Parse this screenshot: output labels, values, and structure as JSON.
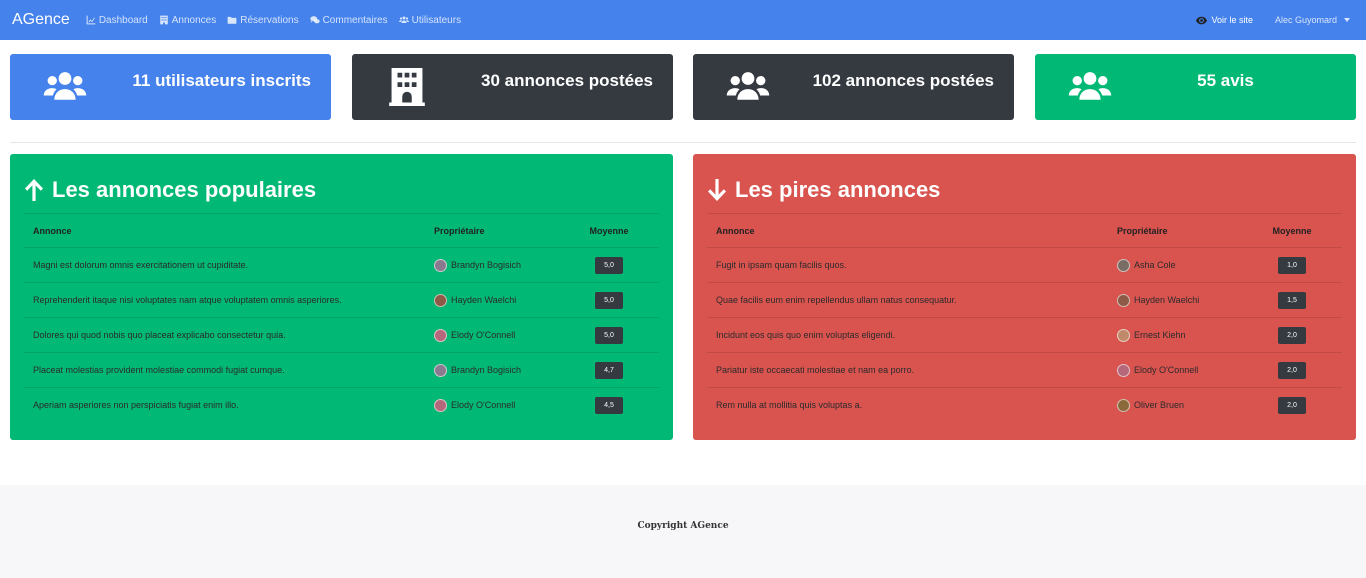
{
  "nav": {
    "brand": "AGence",
    "links": [
      {
        "label": "Dashboard",
        "icon": "chart-line-icon"
      },
      {
        "label": "Annonces",
        "icon": "building-icon"
      },
      {
        "label": "Réservations",
        "icon": "folder-icon"
      },
      {
        "label": "Commentaires",
        "icon": "comments-icon"
      },
      {
        "label": "Utilisateurs",
        "icon": "users-icon"
      }
    ],
    "view_site": "Voir le site",
    "user": "Alec Guyomard"
  },
  "stats": [
    {
      "text": "11 utilisateurs inscrits",
      "icon": "users-icon",
      "color": "#4582ec"
    },
    {
      "text": "30 annonces postées",
      "icon": "building-icon",
      "color": "#343a40"
    },
    {
      "text": "102 annonces postées",
      "icon": "users-icon",
      "color": "#343a40"
    },
    {
      "text": "55 avis",
      "icon": "users-icon",
      "color": "#02b875"
    }
  ],
  "popular": {
    "title": "Les annonces populaires",
    "headers": {
      "annonce": "Annonce",
      "owner": "Propriétaire",
      "avg": "Moyenne"
    },
    "rows": [
      {
        "annonce": "Magni est dolorum omnis exercitationem ut cupiditate.",
        "owner": "Brandyn Bogisich",
        "avg": "5,0",
        "avatar_color": "#8a7a8f"
      },
      {
        "annonce": "Reprehenderit itaque nisi voluptates nam atque voluptatem omnis asperiores.",
        "owner": "Hayden Waelchi",
        "avg": "5,0",
        "avatar_color": "#8c5a47"
      },
      {
        "annonce": "Dolores qui quod nobis quo placeat explicabo consectetur quia.",
        "owner": "Elody O'Connell",
        "avg": "5,0",
        "avatar_color": "#b4687a"
      },
      {
        "annonce": "Placeat molestias provident molestiae commodi fugiat cumque.",
        "owner": "Brandyn Bogisich",
        "avg": "4,7",
        "avatar_color": "#8a7a8f"
      },
      {
        "annonce": "Aperiam asperiores non perspiciatis fugiat enim illo.",
        "owner": "Elody O'Connell",
        "avg": "4,5",
        "avatar_color": "#b4687a"
      }
    ]
  },
  "worst": {
    "title": "Les pires annonces",
    "headers": {
      "annonce": "Annonce",
      "owner": "Propriétaire",
      "avg": "Moyenne"
    },
    "rows": [
      {
        "annonce": "Fugit in ipsam quam facilis quos.",
        "owner": "Asha Cole",
        "avg": "1,0",
        "avatar_color": "#7a6d66"
      },
      {
        "annonce": "Quae facilis eum enim repellendus ullam natus consequatur.",
        "owner": "Hayden Waelchi",
        "avg": "1,5",
        "avatar_color": "#8c5a47"
      },
      {
        "annonce": "Incidunt eos quis quo enim voluptas eligendi.",
        "owner": "Ernest Kiehn",
        "avg": "2,0",
        "avatar_color": "#c08a6a"
      },
      {
        "annonce": "Pariatur iste occaecati molestiae et nam ea porro.",
        "owner": "Elody O'Connell",
        "avg": "2,0",
        "avatar_color": "#b4687a"
      },
      {
        "annonce": "Rem nulla at mollitia quis voluptas a.",
        "owner": "Oliver Bruen",
        "avg": "2,0",
        "avatar_color": "#8a6a3a"
      }
    ]
  },
  "footer": "Copyright AGence"
}
